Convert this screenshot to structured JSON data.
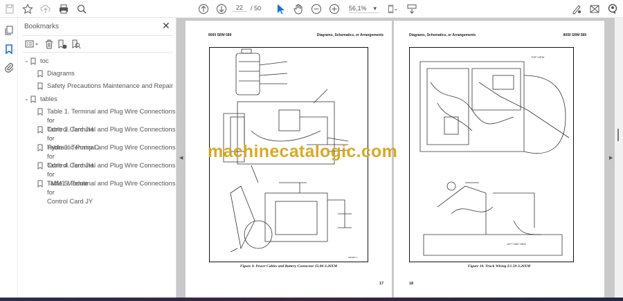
{
  "toolbar": {
    "page_current": "22",
    "page_total": "/ 50",
    "zoom": "56,1%",
    "zoom_caret": "▾"
  },
  "bookmarks": {
    "title": "Bookmarks",
    "close": "✕",
    "groups": [
      {
        "label": "toc",
        "items": [
          "Diagrams",
          "Safety Precautions Maintenance and Repair"
        ]
      },
      {
        "label": "tables",
        "items": [
          [
            "Table 1. Terminal and Plug Wire Connections for",
            "Control Card JH"
          ],
          [
            "Table 2. Terminal and Plug Wire Connections for",
            "Hydraulic Pump C"
          ],
          [
            "Table 3. Terminal and Plug Wire Connections for",
            "Control Card JH"
          ],
          [
            "Table 4. Terminal and Plug Wire Connections for",
            "TMM1 Module"
          ],
          [
            "Table 5. Terminal and Plug Wire Connections for",
            "Control Card JY"
          ]
        ]
      }
    ]
  },
  "pages": {
    "left": {
      "header_left": "8000 SRM 589",
      "header_right": "Diagrams, Schematics, or Arrangements",
      "caption": "Figure 9.  Power Cables and Battery Connector J2.00-3.20XM",
      "page_number": "17"
    },
    "right": {
      "header_left": "Diagrams, Schematics, or Arrangements",
      "header_right": "8000 SRM 589",
      "caption": "Figure 10.  Truck Wiring E1.50-3.20XM",
      "page_number": "18",
      "view_top": "TOP VIEW",
      "view_side": "LEFT SIDE VIEW"
    }
  },
  "watermark": "machinecatalogic.com",
  "colors": {
    "accent": "#1a6fd1",
    "watermark": "#d6a61c"
  }
}
